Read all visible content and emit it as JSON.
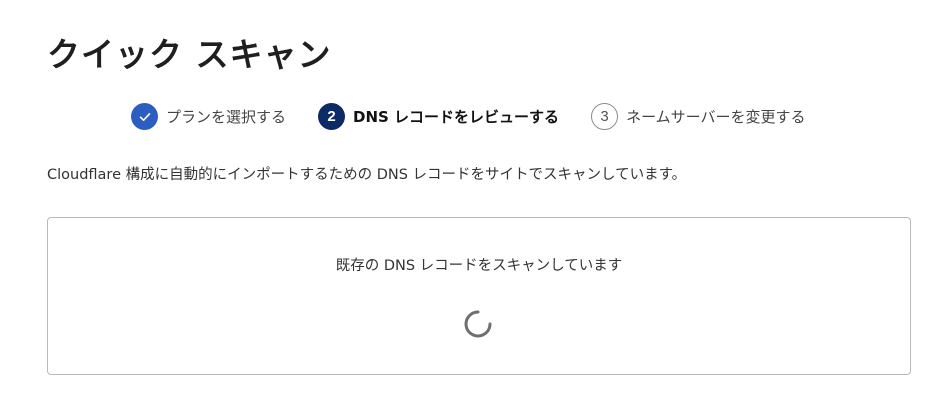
{
  "page": {
    "title": "クイック スキャン",
    "description": "Cloudflare 構成に自動的にインポートするための DNS レコードをサイトでスキャンしています。"
  },
  "stepper": {
    "steps": [
      {
        "number": "1",
        "label": "プランを選択する",
        "state": "completed",
        "icon": "check-icon"
      },
      {
        "number": "2",
        "label": "DNS レコードをレビューする",
        "state": "current"
      },
      {
        "number": "3",
        "label": "ネームサーバーを変更する",
        "state": "pending"
      }
    ]
  },
  "scan": {
    "status_text": "既存の DNS レコードをスキャンしています",
    "icon": "loading-spinner-icon"
  },
  "colors": {
    "completed_step": "#2c5ec2",
    "current_step": "#0b2a66",
    "pending_border": "#8a8a8a",
    "panel_border": "#b9b9b9",
    "spinner": "#6f6f6f"
  }
}
